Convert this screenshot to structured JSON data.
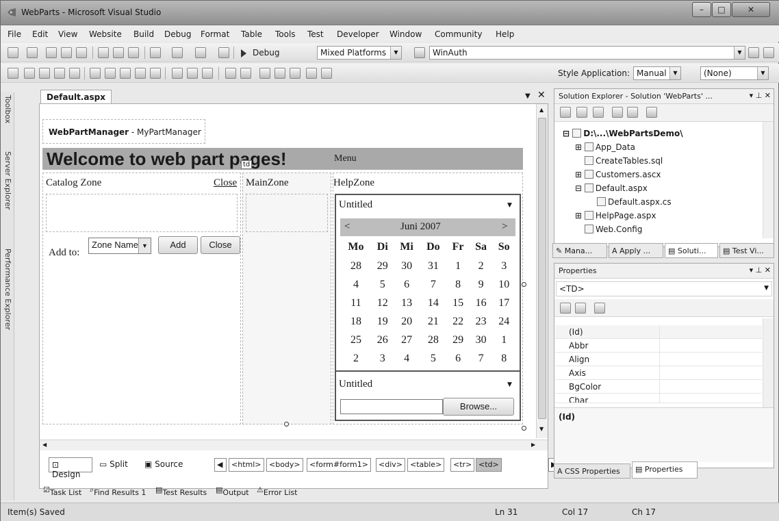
{
  "window": {
    "title": "WebParts - Microsoft Visual Studio"
  },
  "menu": [
    "File",
    "Edit",
    "View",
    "Website",
    "Build",
    "Debug",
    "Format",
    "Table",
    "Tools",
    "Test",
    "Developer",
    "Window",
    "Community",
    "Help"
  ],
  "toolbar": {
    "config": "Debug",
    "platform": "Mixed Platforms",
    "search": "WinAuth",
    "style_label": "Style Application:",
    "style_value": "Manual",
    "target_rule": "(None)"
  },
  "left_strip": [
    "Toolbox",
    "Server Explorer",
    "Performance Explorer"
  ],
  "document": {
    "tab": "Default.aspx",
    "webpartmanager_label": "WebPartManager",
    "webpartmanager_id": " - MyPartManager",
    "heading": "Welcome to web part pages!",
    "td_tag": "td",
    "menu_label": "Menu",
    "catalog_zone": "Catalog Zone",
    "close_link": "Close",
    "main_zone": "MainZone",
    "help_zone": "HelpZone",
    "add_to_label": "Add to:",
    "zone_select": "Zone Name",
    "add_button": "Add",
    "close_button": "Close",
    "untitled_1": "Untitled",
    "untitled_2": "Untitled",
    "browse_button": "Browse...",
    "calendar": {
      "prev": "<",
      "next": ">",
      "month": "Juni 2007",
      "days": [
        "Mo",
        "Di",
        "Mi",
        "Do",
        "Fr",
        "Sa",
        "So"
      ],
      "weeks": [
        [
          "28",
          "29",
          "30",
          "31",
          "1",
          "2",
          "3"
        ],
        [
          "4",
          "5",
          "6",
          "7",
          "8",
          "9",
          "10"
        ],
        [
          "11",
          "12",
          "13",
          "14",
          "15",
          "16",
          "17"
        ],
        [
          "18",
          "19",
          "20",
          "21",
          "22",
          "23",
          "24"
        ],
        [
          "25",
          "26",
          "27",
          "28",
          "29",
          "30",
          "1"
        ],
        [
          "2",
          "3",
          "4",
          "5",
          "6",
          "7",
          "8"
        ]
      ]
    }
  },
  "view_tabs": {
    "design": "Design",
    "split": "Split",
    "source": "Source",
    "tags": [
      "<html>",
      "<body>",
      "<form#form1>",
      "<div>",
      "<table>",
      "<tr>",
      "<td>"
    ]
  },
  "bottom_tabs": [
    "Task List",
    "Find Results 1",
    "Test Results",
    "Output",
    "Error List"
  ],
  "solution_explorer": {
    "title": "Solution Explorer - Solution 'WebParts' ...",
    "root": "D:\\...\\WebPartsDemo\\",
    "items": [
      "App_Data",
      "CreateTables.sql",
      "Customers.ascx",
      "Default.aspx",
      "Default.aspx.cs",
      "HelpPage.aspx",
      "Web.Config"
    ],
    "tabs": [
      "Mana...",
      "Apply ...",
      "Soluti...",
      "Test Vi..."
    ]
  },
  "properties": {
    "title": "Properties",
    "object": "<TD>",
    "rows": [
      "(Id)",
      "Abbr",
      "Align",
      "Axis",
      "BgColor",
      "Char"
    ],
    "description": "(Id)",
    "tabs": [
      "CSS Properties",
      "Properties"
    ]
  },
  "status": {
    "message": "Item(s) Saved",
    "ln": "Ln 31",
    "col": "Col 17",
    "ch": "Ch 17"
  }
}
